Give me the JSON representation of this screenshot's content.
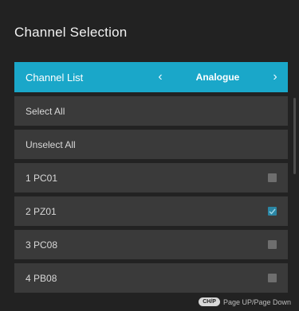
{
  "screen": {
    "title": "Channel Selection"
  },
  "channel_list": {
    "label": "Channel List",
    "value": "Analogue",
    "prev_icon": "chevron-left-icon",
    "next_icon": "chevron-right-icon"
  },
  "actions": {
    "select_all": "Select All",
    "unselect_all": "Unselect All"
  },
  "channels": [
    {
      "label": "1 PC01",
      "checked": false
    },
    {
      "label": "2 PZ01",
      "checked": true
    },
    {
      "label": "3 PC08",
      "checked": false
    },
    {
      "label": "4 PB08",
      "checked": false
    }
  ],
  "footer": {
    "key": "CH/P",
    "hint": "Page UP/Page Down"
  },
  "colors": {
    "accent": "#1aa7c9",
    "row_bg": "#3a3a3a",
    "background": "#222222"
  }
}
